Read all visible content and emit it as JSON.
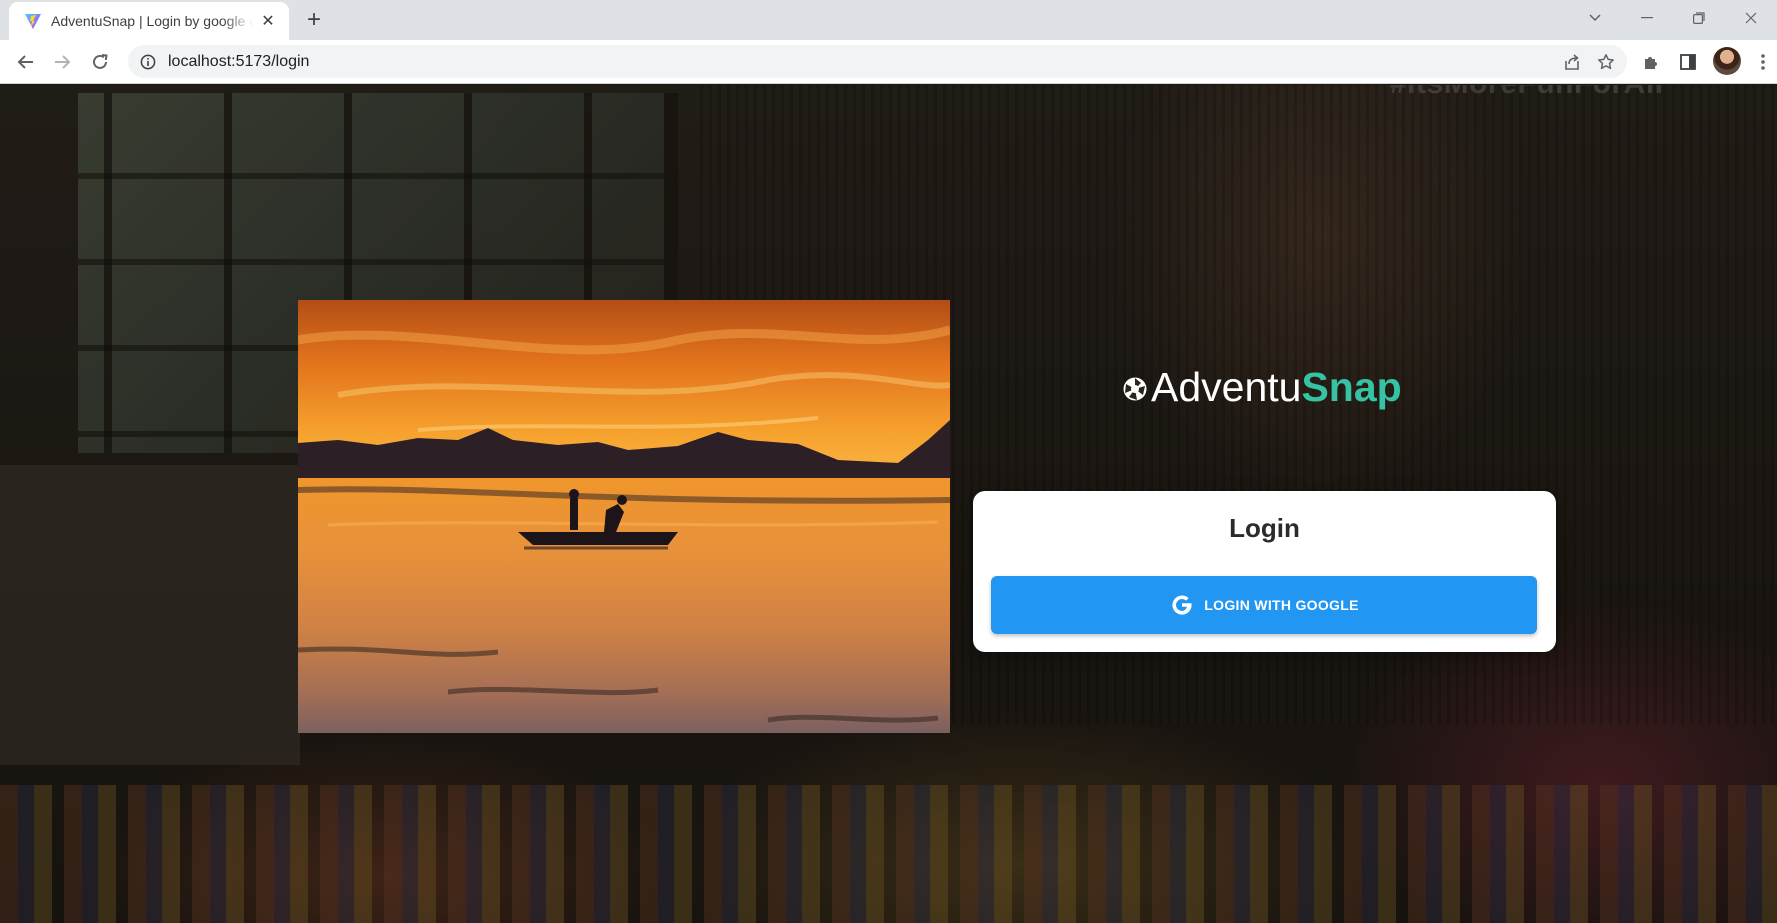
{
  "browser": {
    "tab_title": "AdventuSnap | Login by google a",
    "url": "localhost:5173/login",
    "colors": {
      "tabbar": "#dee1e6",
      "toolbar": "#ffffff",
      "omnibox": "#f1f3f4"
    }
  },
  "page": {
    "background_caption": "#ItsMoreFunForAll",
    "brand": {
      "part1": "Adventu",
      "part2": "Snap",
      "accent": "#35c3a4"
    },
    "login": {
      "title": "Login",
      "google_button_label": "LOGIN WITH GOOGLE",
      "button_color": "#2196f3"
    }
  },
  "icons": {
    "favicon": "vite-logo-icon",
    "back": "arrow-left-icon",
    "forward": "arrow-right-icon",
    "reload": "reload-icon",
    "info": "info-icon",
    "share": "share-icon",
    "bookmark": "star-icon",
    "extensions": "puzzle-icon",
    "side_panel": "side-panel-icon",
    "menu": "kebab-menu-icon",
    "brand": "camera-aperture-icon",
    "google": "google-g-icon"
  }
}
